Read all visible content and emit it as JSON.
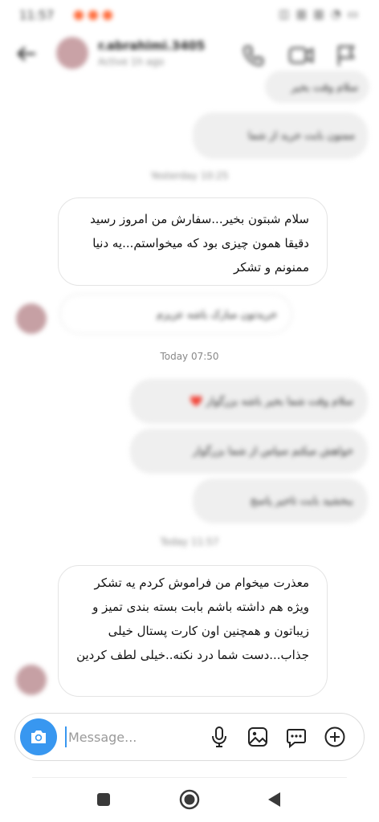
{
  "status_bar": {
    "time": "11:57",
    "right": "◫ ▥ ▥ ◔ ▭"
  },
  "header": {
    "name": "r.abrahimi.3405",
    "subtitle": "Active 1h ago"
  },
  "messages": {
    "blur_out_1": "سلام وقت بخیر",
    "blur_out_2": "ممنون بابت خرید از شما",
    "blur_ts_1": "Yesterday 10:25",
    "in_1": "سلام شبتون بخیر...سفارش من امروز رسید دقیقا همون چیزی بود که میخواستم...یه دنیا ممنونم و تشکر",
    "blur_in_2": "خریدتون مبارک باشه عزیزم",
    "ts_today": "Today 07:50",
    "blur_out_3": "سلام وقت شما بخیر باشه بزرگوار ❤️",
    "blur_out_4": "خواهش میکنم سپاس از شما بزرگوار",
    "blur_out_5": "ببخشید بابت تاخیر پاسخ",
    "blur_ts_2": "Today 11:57",
    "in_2": "معذرت میخوام من فراموش کردم یه تشکر ویژه هم داشته باشم بابت بسته بندی تمیز و زیباتون و همچنین اون کارت پستال خیلی جذاب...دست شما درد نکنه..خیلی لطف کردین"
  },
  "composer": {
    "placeholder": "Message..."
  },
  "colors": {
    "accent": "#3897f0",
    "bubble_out": "#efefef",
    "border": "#e4e4e4"
  }
}
